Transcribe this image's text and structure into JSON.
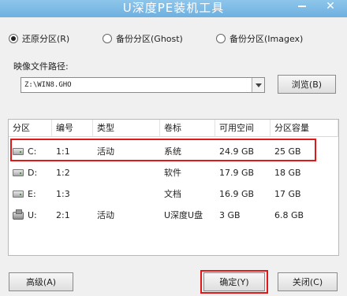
{
  "window": {
    "title": "U深度PE装机工具",
    "minimize_label": "—",
    "close_label": "✕"
  },
  "mode": {
    "options": [
      {
        "label": "还原分区(R)",
        "selected": true
      },
      {
        "label": "备份分区(Ghost)",
        "selected": false
      },
      {
        "label": "备份分区(Imagex)",
        "selected": false
      }
    ]
  },
  "image_path": {
    "label": "映像文件路径:",
    "value": "Z:\\WIN8.GHO",
    "browse_label": "浏览(B)"
  },
  "table": {
    "headers": [
      "分区",
      "编号",
      "类型",
      "卷标",
      "可用空间",
      "分区容量"
    ],
    "rows": [
      {
        "icon": "hard-drive-icon",
        "partition": "C:",
        "number": "1:1",
        "type": "活动",
        "label": "系统",
        "free": "24.9 GB",
        "capacity": "25 GB"
      },
      {
        "icon": "hard-drive-icon",
        "partition": "D:",
        "number": "1:2",
        "type": "",
        "label": "软件",
        "free": "17.9 GB",
        "capacity": "18 GB"
      },
      {
        "icon": "hard-drive-icon",
        "partition": "E:",
        "number": "1:3",
        "type": "",
        "label": "文档",
        "free": "16.9 GB",
        "capacity": "17 GB"
      },
      {
        "icon": "usb-drive-icon",
        "partition": "U:",
        "number": "2:1",
        "type": "活动",
        "label": "U深度U盘",
        "free": "3 GB",
        "capacity": "6.8 GB"
      }
    ],
    "highlight_color": "#e01818"
  },
  "buttons": {
    "advanced": "高级(A)",
    "ok": "确定(Y)",
    "close": "关闭(C)"
  },
  "colors": {
    "titlebar": "#7ab8e4",
    "highlight": "#e01818"
  }
}
